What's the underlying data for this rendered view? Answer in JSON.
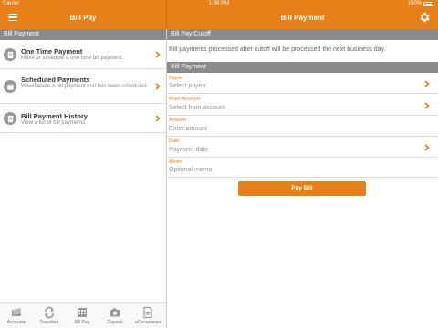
{
  "status_bar": {
    "carrier": "Carrier",
    "time": "1:36 PM",
    "battery": "100%"
  },
  "left_panel": {
    "title": "Bill Pay",
    "section_header": "Bill Payment",
    "items": [
      {
        "title": "One Time Payment",
        "description": "Make or schedule a one time bill payment.",
        "icon": "document-icon"
      },
      {
        "title": "Scheduled Payments",
        "description": "View/Delete a bill payment that has been scheduled.",
        "icon": "calendar-icon"
      },
      {
        "title": "Bill Payment History",
        "description": "View a list of bill payments.",
        "icon": "history-icon"
      }
    ]
  },
  "right_panel": {
    "title": "Bill Payment",
    "cutoff_header": "Bill Pay Cutoff",
    "cutoff_text": "Bill payments processed after cutoff will be processed the next business day.",
    "form_header": "Bill Payment",
    "fields": [
      {
        "label": "Payee",
        "placeholder": "Select payee",
        "has_chevron": true
      },
      {
        "label": "From Account",
        "placeholder": "Select from account",
        "has_chevron": true
      },
      {
        "label": "Amount",
        "placeholder": "Enter amount",
        "has_chevron": false
      },
      {
        "label": "Date",
        "placeholder": "Payment date",
        "has_chevron": true
      },
      {
        "label": "Memo",
        "placeholder": "Optional memo",
        "has_chevron": false
      }
    ],
    "submit_label": "Pay Bill"
  },
  "tabs": [
    {
      "label": "Accounts",
      "icon": "accounts-icon"
    },
    {
      "label": "Transfers",
      "icon": "transfers-icon"
    },
    {
      "label": "Bill Pay",
      "icon": "bill-pay-icon"
    },
    {
      "label": "Deposit",
      "icon": "camera-icon"
    },
    {
      "label": "eDocuments",
      "icon": "edocuments-icon"
    }
  ],
  "colors": {
    "accent": "#e8801a",
    "section_gray": "#8a8a8a"
  }
}
